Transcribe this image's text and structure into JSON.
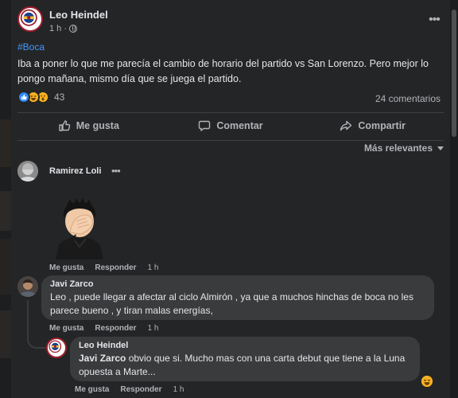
{
  "post": {
    "author": "Leo Heindel",
    "time": "1 h ·",
    "more_label": "•••",
    "hashtag": "#Boca",
    "text": "Iba a poner lo que me parecía el cambio de horario del partido vs San Lorenzo. Pero mejor lo pongo mañana, mismo día que se juega el partido.",
    "reaction_count": "43",
    "comments_count": "24 comentarios",
    "reactions": [
      "like",
      "haha",
      "wow"
    ]
  },
  "actions": {
    "like": "Me gusta",
    "comment": "Comentar",
    "share": "Compartir"
  },
  "sort_label": "Más relevantes",
  "comments": [
    {
      "name": "Ramirez Loli",
      "more": "•••",
      "sticker": "facepalm-memoji-sticker",
      "like": "Me gusta",
      "reply": "Responder",
      "time": "1 h"
    },
    {
      "name": "Javi Zarco",
      "text": "Leo , puede llegar a afectar al ciclo Almirón , ya que a muchos hinchas de boca no les parece bueno , y tiran malas energías,",
      "like": "Me gusta",
      "reply": "Responder",
      "time": "1 h"
    },
    {
      "name": "Leo Heindel",
      "mention": "Javi Zarco",
      "text": " obvio que si. Mucho mas con una carta debut que tiene a la Luna opuesta a Marte...",
      "like": "Me gusta",
      "reply": "Responder",
      "time": "1 h",
      "reaction": "haha"
    }
  ],
  "colors": {
    "card": "#242526",
    "bubble": "#3a3b3c",
    "link": "#4599ff",
    "secondary_text": "#b0b3b8",
    "like_blue": "#2d88ff",
    "boca_red": "#9c1d2c"
  }
}
